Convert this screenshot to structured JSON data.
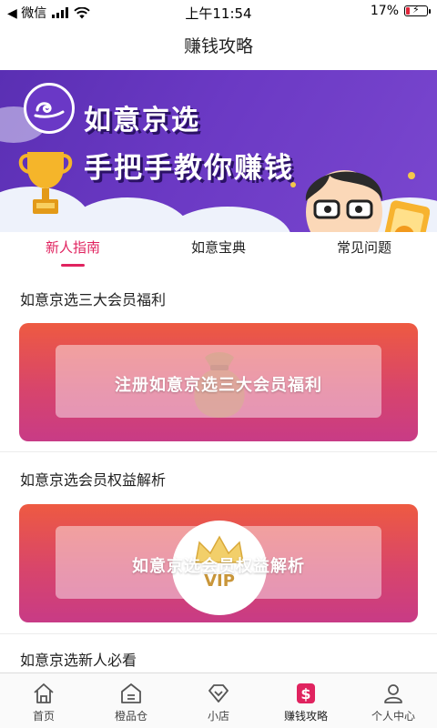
{
  "status_bar": {
    "back_label": "◀ 微信",
    "time": "上午11:54",
    "battery_pct": "17%",
    "battery_level": 0.17
  },
  "header": {
    "title": "赚钱攻略"
  },
  "banner": {
    "line1": "如意京选",
    "line2": "手把手教你赚钱"
  },
  "tabs": [
    {
      "label": "新人指南",
      "active": true
    },
    {
      "label": "如意宝典",
      "active": false
    },
    {
      "label": "常见问题",
      "active": false
    }
  ],
  "sections": [
    {
      "title": "如意京选三大会员福利",
      "card_label": "注册如意京选三大会员福利"
    },
    {
      "title": "如意京选会员权益解析",
      "card_label": "如意京选会员权益解析",
      "badge_text": "VIP"
    },
    {
      "title": "如意京选新人必看"
    }
  ],
  "bottom_nav": [
    {
      "label": "首页",
      "icon": "home-icon"
    },
    {
      "label": "橙品仓",
      "icon": "warehouse-icon"
    },
    {
      "label": "小店",
      "icon": "diamond-icon"
    },
    {
      "label": "赚钱攻略",
      "icon": "dollar-icon",
      "active": true
    },
    {
      "label": "个人中心",
      "icon": "person-icon"
    }
  ],
  "colors": {
    "accent": "#e0235f",
    "banner_purple": "#6b39c4",
    "card_top": "#ee5a41",
    "card_bottom": "#c83b86"
  }
}
